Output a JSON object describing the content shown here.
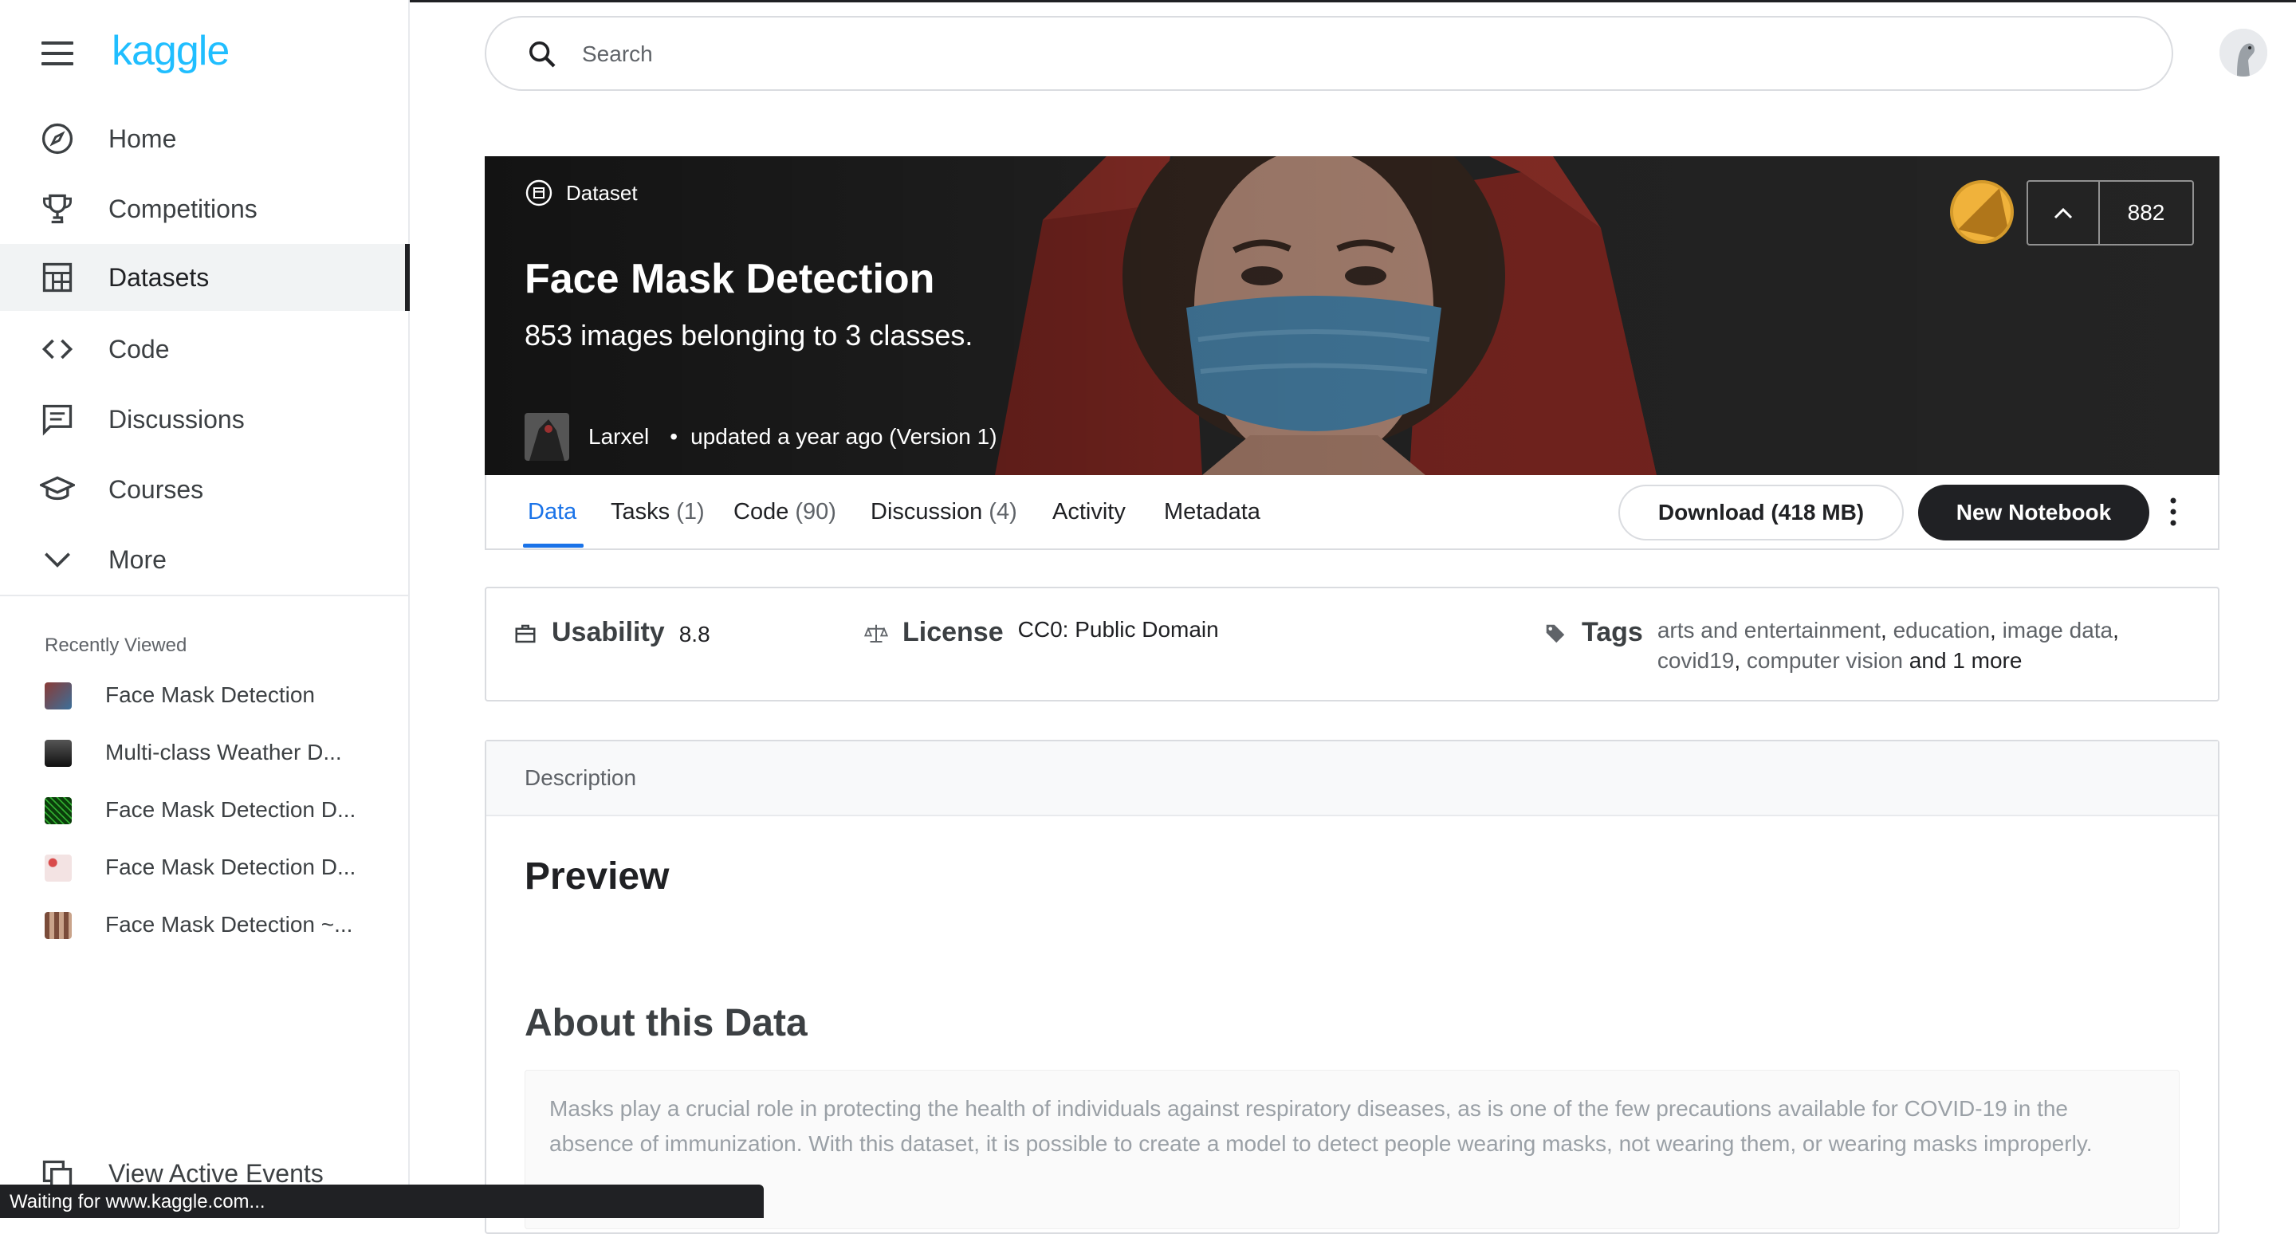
{
  "app": {
    "logo": "kaggle"
  },
  "search": {
    "placeholder": "Search"
  },
  "sidebar": {
    "items": [
      {
        "label": "Home",
        "icon": "compass-icon"
      },
      {
        "label": "Competitions",
        "icon": "trophy-icon"
      },
      {
        "label": "Datasets",
        "icon": "table-icon",
        "active": true
      },
      {
        "label": "Code",
        "icon": "code-brackets-icon"
      },
      {
        "label": "Discussions",
        "icon": "comments-icon"
      },
      {
        "label": "Courses",
        "icon": "graduation-cap-icon"
      },
      {
        "label": "More",
        "icon": "chevron-down-icon"
      }
    ],
    "recently_viewed_title": "Recently Viewed",
    "recently_viewed": [
      {
        "label": "Face Mask Detection"
      },
      {
        "label": "Multi-class Weather D..."
      },
      {
        "label": "Face Mask Detection D..."
      },
      {
        "label": "Face Mask Detection D..."
      },
      {
        "label": "Face Mask Detection ~..."
      }
    ],
    "active_events": "View Active Events"
  },
  "hero": {
    "type_label": "Dataset",
    "title": "Face Mask Detection",
    "subtitle": "853 images belonging to 3 classes.",
    "author": "Larxel",
    "updated": "updated a year ago (Version 1)",
    "votes": "882"
  },
  "tabs": [
    {
      "label": "Data",
      "count": "",
      "active": true
    },
    {
      "label": "Tasks",
      "count": "(1)"
    },
    {
      "label": "Code",
      "count": "(90)"
    },
    {
      "label": "Discussion",
      "count": "(4)"
    },
    {
      "label": "Activity",
      "count": ""
    },
    {
      "label": "Metadata",
      "count": ""
    }
  ],
  "actions": {
    "download": "Download (418 MB)",
    "new_notebook": "New Notebook"
  },
  "meta": {
    "usability_label": "Usability",
    "usability_value": "8.8",
    "license_label": "License",
    "license_value": "CC0: Public Domain",
    "tags_label": "Tags",
    "tags": [
      "arts and entertainment",
      "education",
      "image data",
      "covid19",
      "computer vision"
    ],
    "tags_more": "and 1 more"
  },
  "description": {
    "header": "Description",
    "preview_heading": "Preview",
    "about_heading": "About this Data",
    "about_text": "Masks play a crucial role in protecting the health of individuals against respiratory diseases, as is one of the few precautions available for COVID-19 in the absence of immunization. With this dataset, it is possible to create a model to detect people wearing masks, not wearing them, or wearing masks improperly."
  },
  "statusbar": {
    "text": "Waiting for www.kaggle.com..."
  },
  "colors": {
    "brand": "#20beff",
    "accent": "#1a73e8",
    "dark": "#202124",
    "medal": "#f0b23b"
  }
}
